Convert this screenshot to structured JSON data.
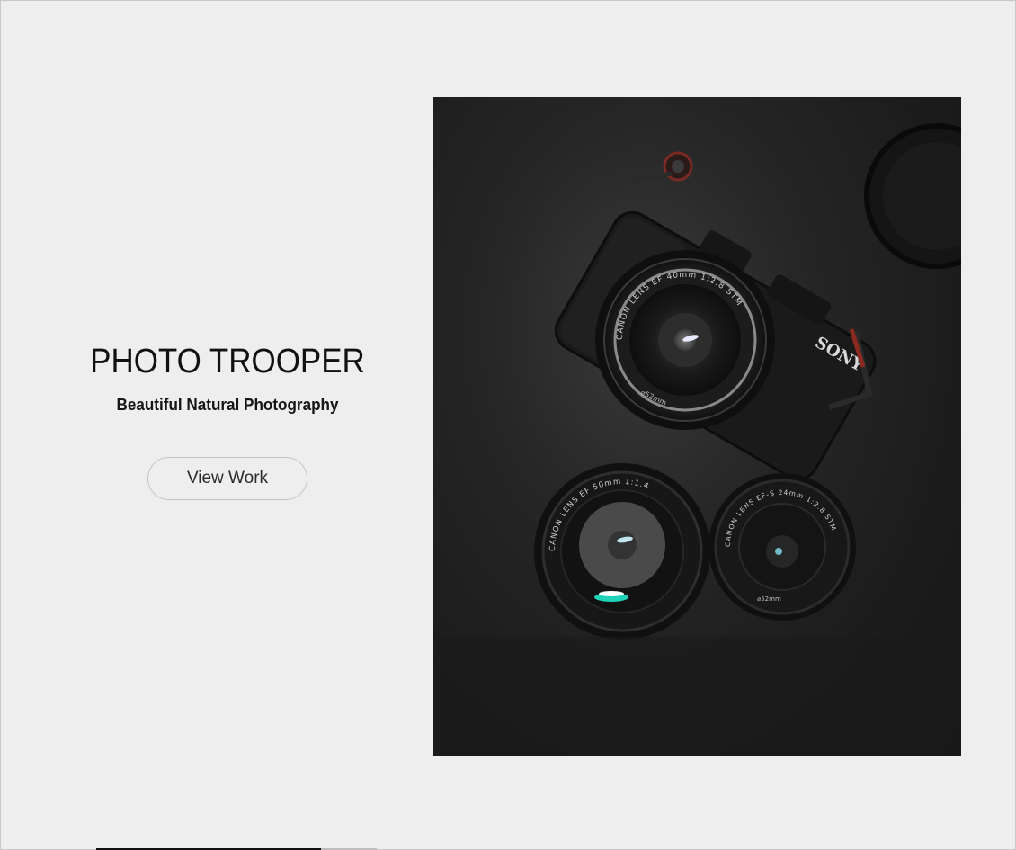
{
  "hero": {
    "title": "PHOTO TROOPER",
    "subtitle": "Beautiful Natural Photography",
    "cta_label": "View Work"
  },
  "photo": {
    "body_brand": "SONY",
    "main_lens_text": "CANON  LENS  EF  40mm  1:2.8  STM",
    "main_lens_filter": "⌀52mm",
    "lens_left_text": "CANON  LENS  EF  50mm  1:1.4",
    "lens_right_text": "CANON  LENS  EF-S  24mm  1:2.8  STM",
    "lens_right_filter": "⌀52mm"
  },
  "colors": {
    "page_background": "#eeeeee",
    "photo_background": "#1e1e1e",
    "title_color": "#111111"
  }
}
